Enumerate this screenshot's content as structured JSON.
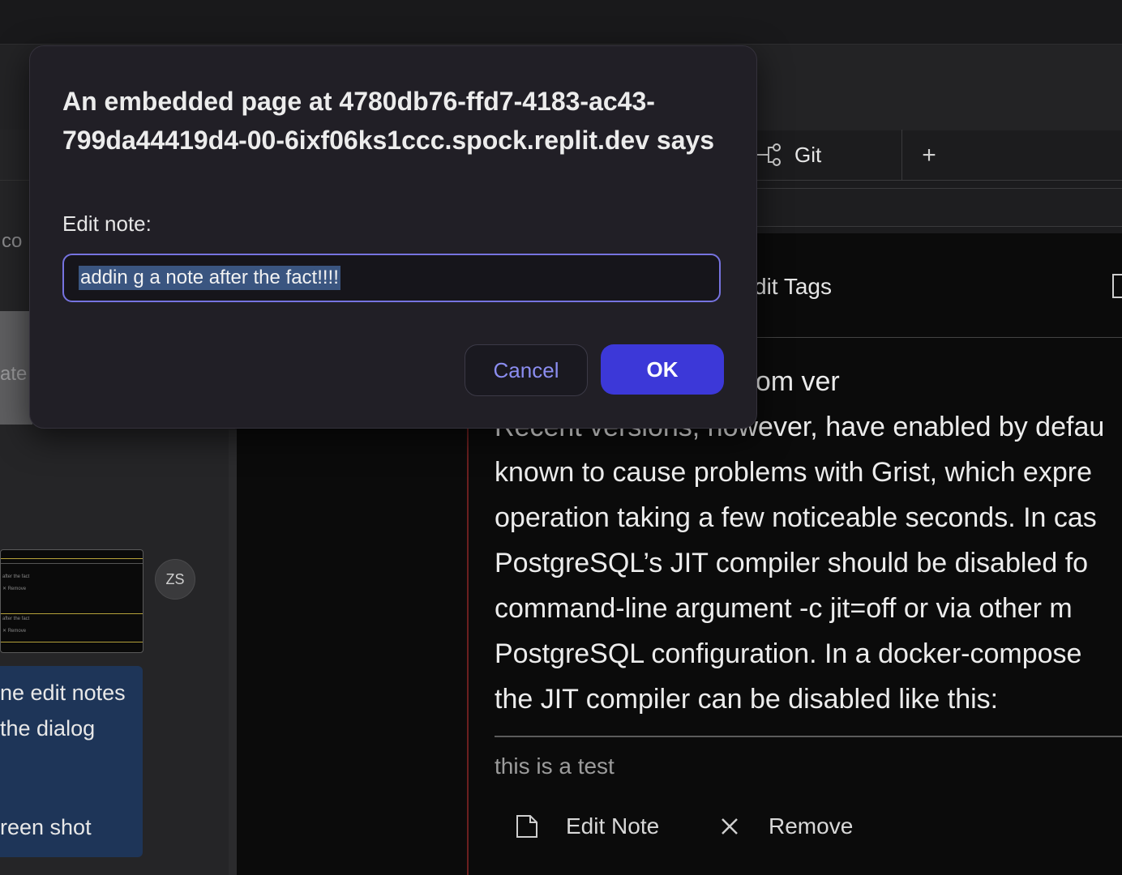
{
  "dialog": {
    "title": "An embedded page at 4780db76-ffd7-4183-ac43-799da44419d4-00-6ixf06ks1ccc.spock.replit.dev says",
    "prompt": "Edit note:",
    "input_value": "addin g a note after the fact!!!!",
    "cancel_label": "Cancel",
    "ok_label": "OK"
  },
  "tabs": {
    "git_label": "Git",
    "add_label": "+"
  },
  "sidebar": {
    "partial_text_1": "co",
    "partial_text_2": "ate (",
    "avatar_initials": "ZS",
    "note_lines": [
      "ne edit notes",
      " the dialog",
      "reen shot"
    ]
  },
  "content": {
    "edit_tags_label": "dit Tags",
    "paragraph_lines": [
      "rk with PostgreSQL from ver",
      "Recent versions, however, have enabled by defau",
      "known to cause problems with Grist, which expre",
      "operation taking a few noticeable seconds. In cas",
      "PostgreSQL’s JIT compiler should be disabled fo",
      "command-line argument -c jit=off or via other m",
      "PostgreSQL configuration. In a docker-compose",
      "the JIT compiler can be disabled like this:"
    ],
    "note_text": "this is a test",
    "edit_note_label": "Edit Note",
    "remove_label": "Remove"
  },
  "colors": {
    "dialog_bg": "#211f26",
    "ok_button": "#3c38d8",
    "cancel_text": "#8b8df0",
    "input_border": "#7673e0",
    "note_card": "#1e3558"
  }
}
